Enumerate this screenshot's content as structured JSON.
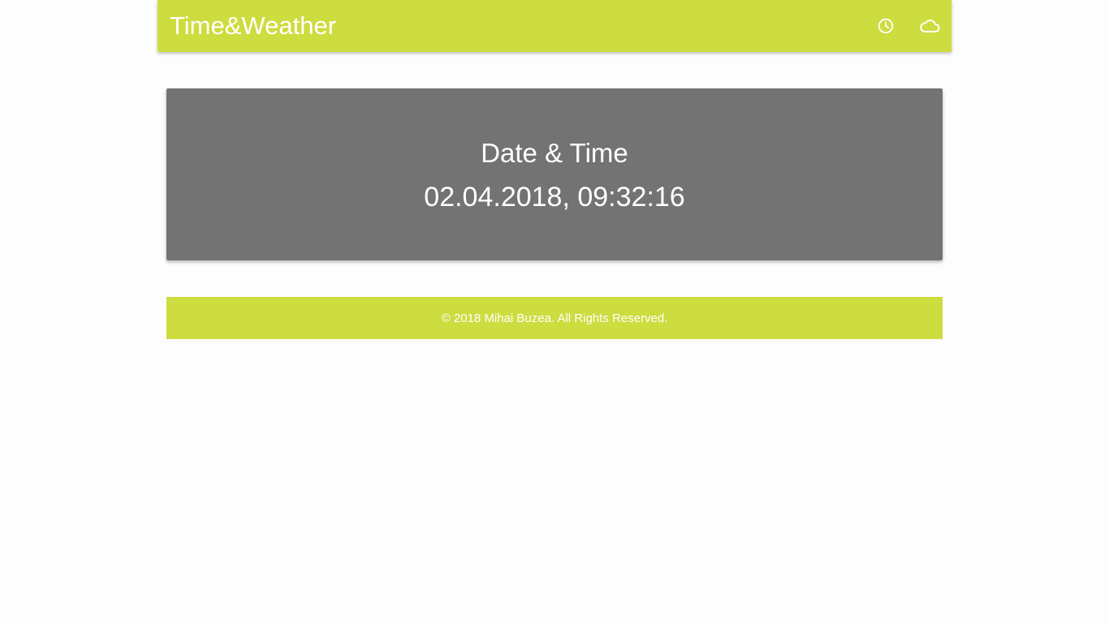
{
  "navbar": {
    "brand": "Time&Weather",
    "icons": [
      "clock-icon",
      "cloud-icon"
    ],
    "color": "#cddc3f"
  },
  "card": {
    "title": "Date & Time",
    "value": "02.04.2018, 09:32:16",
    "background": "#737373"
  },
  "footer": {
    "text": "© 2018 Mihai Buzea. All Rights Reserved.",
    "color": "#cddc3f"
  }
}
